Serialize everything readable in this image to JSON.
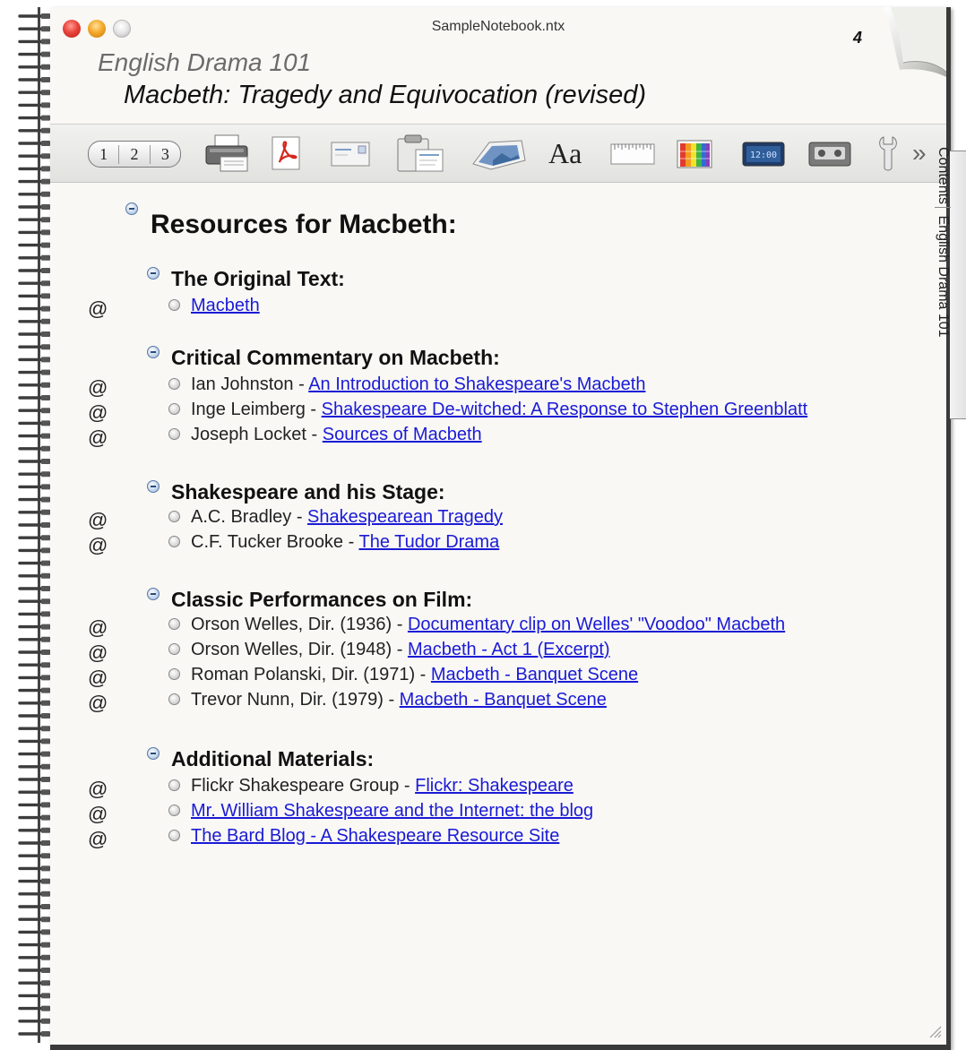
{
  "window": {
    "title": "SampleNotebook.ntx",
    "page_number": "4"
  },
  "header": {
    "notebook_title": "English Drama 101",
    "section_title": "Macbeth: Tragedy and Equivocation (revised)"
  },
  "toolbar": {
    "numbering": [
      "1",
      "2",
      "3"
    ],
    "font_label": "Aa",
    "more_label": "»",
    "icons": [
      "print-icon",
      "pdf-icon",
      "mail-icon",
      "clipboard-icon",
      "image-icon",
      "font-icon",
      "ruler-icon",
      "color-palette-icon",
      "clock-icon",
      "cassette-icon",
      "wrench-icon"
    ]
  },
  "side_tab": {
    "first": "Contents",
    "second": "English Drama 101"
  },
  "outline": {
    "title": "Resources for Macbeth:",
    "link_marker": "@",
    "groups": [
      {
        "title": "The Original Text:",
        "items": [
          {
            "prefix": "",
            "link": "Macbeth"
          }
        ]
      },
      {
        "title": "Critical Commentary on Macbeth:",
        "items": [
          {
            "prefix": "Ian Johnston - ",
            "link": "An Introduction to Shakespeare's Macbeth"
          },
          {
            "prefix": "Inge Leimberg - ",
            "link": "Shakespeare De-witched: A Response to Stephen Greenblatt"
          },
          {
            "prefix": "Joseph Locket - ",
            "link": "Sources of Macbeth"
          }
        ]
      },
      {
        "title": "Shakespeare and his Stage:",
        "items": [
          {
            "prefix": "A.C. Bradley - ",
            "link": "Shakespearean Tragedy"
          },
          {
            "prefix": "C.F. Tucker Brooke - ",
            "link": "The Tudor Drama"
          }
        ]
      },
      {
        "title": "Classic Performances on Film:",
        "items": [
          {
            "prefix": "Orson Welles, Dir. (1936) - ",
            "link": "Documentary clip on Welles' \"Voodoo\" Macbeth"
          },
          {
            "prefix": "Orson Welles, Dir. (1948) - ",
            "link": "Macbeth - Act 1 (Excerpt)"
          },
          {
            "prefix": "Roman Polanski, Dir. (1971) - ",
            "link": "Macbeth - Banquet Scene"
          },
          {
            "prefix": "Trevor Nunn, Dir. (1979) - ",
            "link": "Macbeth - Banquet Scene"
          }
        ]
      },
      {
        "title": "Additional Materials:",
        "items": [
          {
            "prefix": "Flickr Shakespeare Group - ",
            "link": "Flickr: Shakespeare"
          },
          {
            "prefix": "",
            "link": "Mr. William Shakespeare and the Internet: the blog"
          },
          {
            "prefix": "",
            "link": "The Bard Blog - A Shakespeare Resource Site"
          }
        ]
      }
    ]
  }
}
